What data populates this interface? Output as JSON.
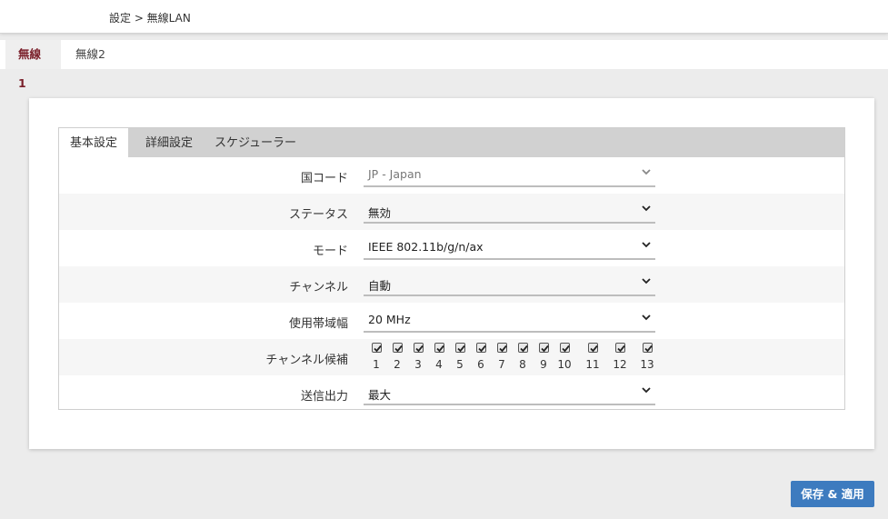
{
  "breadcrumb": "設定 > 無線LAN",
  "wireless_tabs": [
    "無線1",
    "無線2"
  ],
  "panel_tabs": [
    "基本設定",
    "詳細設定",
    "スケジューラー"
  ],
  "fields": {
    "country_code": {
      "label": "国コード",
      "value": "JP - Japan",
      "disabled": true
    },
    "status": {
      "label": "ステータス",
      "value": "無効"
    },
    "mode": {
      "label": "モード",
      "value": "IEEE 802.11b/g/n/ax"
    },
    "channel": {
      "label": "チャンネル",
      "value": "自動"
    },
    "bandwidth": {
      "label": "使用帯域幅",
      "value": "20 MHz"
    },
    "channel_candidates": {
      "label": "チャンネル候補",
      "channels": [
        "1",
        "2",
        "3",
        "4",
        "5",
        "6",
        "7",
        "8",
        "9",
        "10",
        "11",
        "12",
        "13"
      ],
      "all_checked": true
    },
    "tx_power": {
      "label": "送信出力",
      "value": "最大"
    }
  },
  "save_button": "保存 & 適用",
  "colors": {
    "accent": "#7a1f2a",
    "button": "#3d7bbf"
  }
}
